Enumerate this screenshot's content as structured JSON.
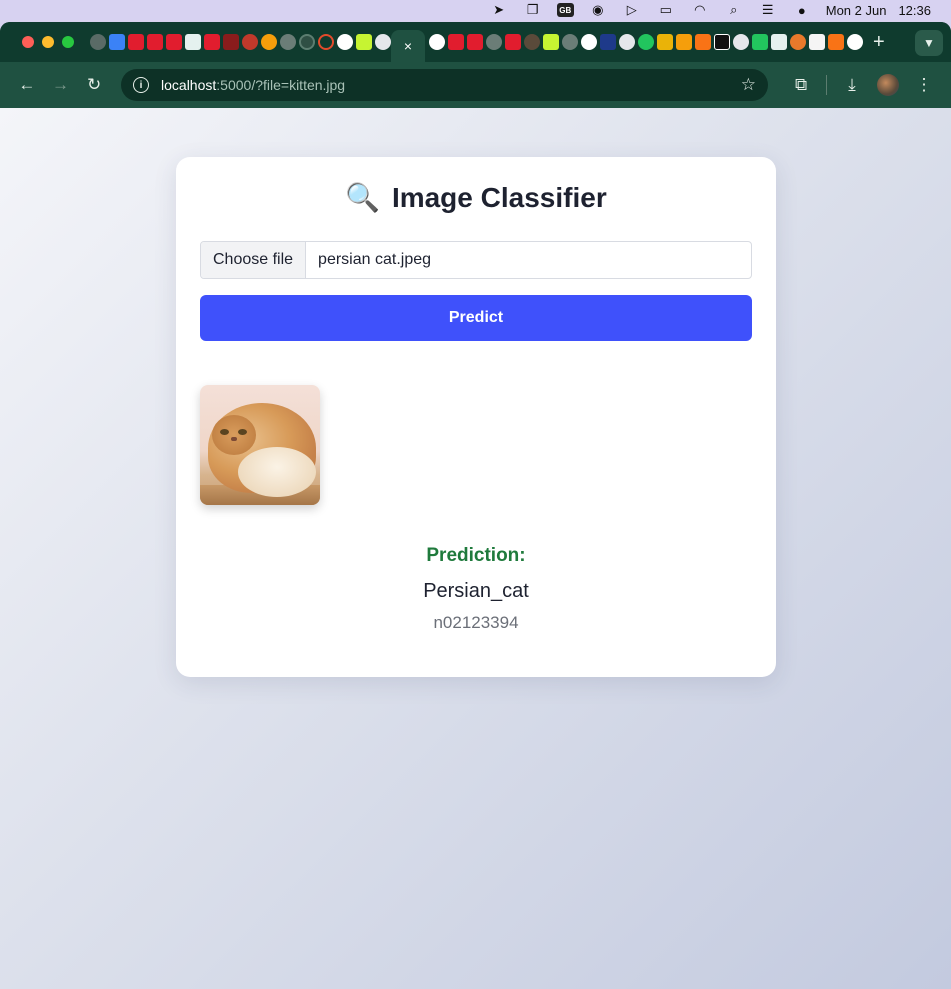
{
  "menubar": {
    "date": "Mon 2 Jun",
    "time": "12:36",
    "icons": [
      "location-icon",
      "window-icon",
      "gb-icon",
      "user-icon",
      "play-icon",
      "battery-icon",
      "wifi-icon",
      "search-icon",
      "control-center-icon",
      "siri-icon"
    ]
  },
  "tabs": {
    "active_close": "×",
    "new_tab": "+"
  },
  "toolbar": {
    "url_host": "localhost",
    "url_rest": ":5000/?file=kitten.jpg"
  },
  "page": {
    "title": "Image Classifier",
    "title_icon": "🔍",
    "choose_file_label": "Choose file",
    "file_name": "persian cat.jpeg",
    "predict_label": "Predict",
    "prediction_label": "Prediction:",
    "prediction_class": "Persian_cat",
    "prediction_id": "n02123394"
  },
  "colors": {
    "accent": "#3f51fb",
    "prediction": "#1f7a3c",
    "tab_bar": "#0f3b2e",
    "toolbar": "#1f5141"
  }
}
